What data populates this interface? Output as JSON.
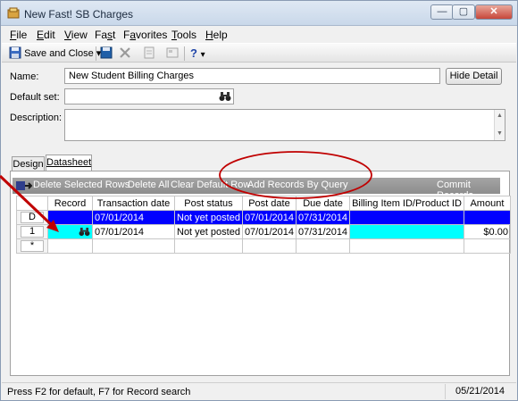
{
  "window": {
    "title": "New Fast! SB Charges",
    "controls": [
      "—",
      "▢",
      "✕"
    ]
  },
  "menu": [
    {
      "label": "File",
      "u": "F",
      "rest": "ile"
    },
    {
      "label": "Edit",
      "u": "E",
      "rest": "dit"
    },
    {
      "label": "View",
      "u": "V",
      "rest": "iew"
    },
    {
      "label": "Fast",
      "pre": "Fa",
      "u": "s",
      "rest": "t"
    },
    {
      "label": "Favorites",
      "pre": "F",
      "u": "a",
      "rest": "vorites"
    },
    {
      "label": "Tools",
      "u": "T",
      "rest": "ools"
    },
    {
      "label": "Help",
      "u": "H",
      "rest": "elp"
    }
  ],
  "toolbar": {
    "save_close_label": "Save and Close",
    "dropdown_arrow": "▾",
    "help_label": "?"
  },
  "form": {
    "name_label": "Name:",
    "name_value": "New Student Billing Charges",
    "hide_detail_label": "Hide Detail",
    "default_set_label": "Default set:",
    "default_set_value": "",
    "description_label": "Description:",
    "description_value": ""
  },
  "tabs": [
    "Design",
    "Datasheet"
  ],
  "grid_toolbar": {
    "delete_selected": "Delete Selected Rows",
    "delete_all": "Delete All",
    "clear_default": "Clear Default Row",
    "add_by_query": "Add Records By Query",
    "commit": "Commit Records"
  },
  "grid": {
    "columns": [
      "Record",
      "Transaction date",
      "Post status",
      "Post date",
      "Due date",
      "Billing Item ID/Product ID",
      "Amount"
    ],
    "rows": [
      {
        "header": "D",
        "record": "",
        "transaction_date": "07/01/2014",
        "post_status": "Not yet posted",
        "post_date": "07/01/2014",
        "due_date": "07/31/2014",
        "billing_item": "",
        "amount": ""
      },
      {
        "header": "1",
        "record": "",
        "transaction_date": "07/01/2014",
        "post_status": "Not yet posted",
        "post_date": "07/01/2014",
        "due_date": "07/31/2014",
        "billing_item": "",
        "amount": "$0.00"
      },
      {
        "header": "*",
        "record": "",
        "transaction_date": "",
        "post_status": "",
        "post_date": "",
        "due_date": "",
        "billing_item": "",
        "amount": ""
      }
    ]
  },
  "status": {
    "hint": "Press F2 for default, F7 for Record search",
    "date": "05/21/2014"
  },
  "colors": {
    "selected_row": "#0000ff",
    "highlight_cell": "#00ffff",
    "annotation": "#c00000"
  }
}
